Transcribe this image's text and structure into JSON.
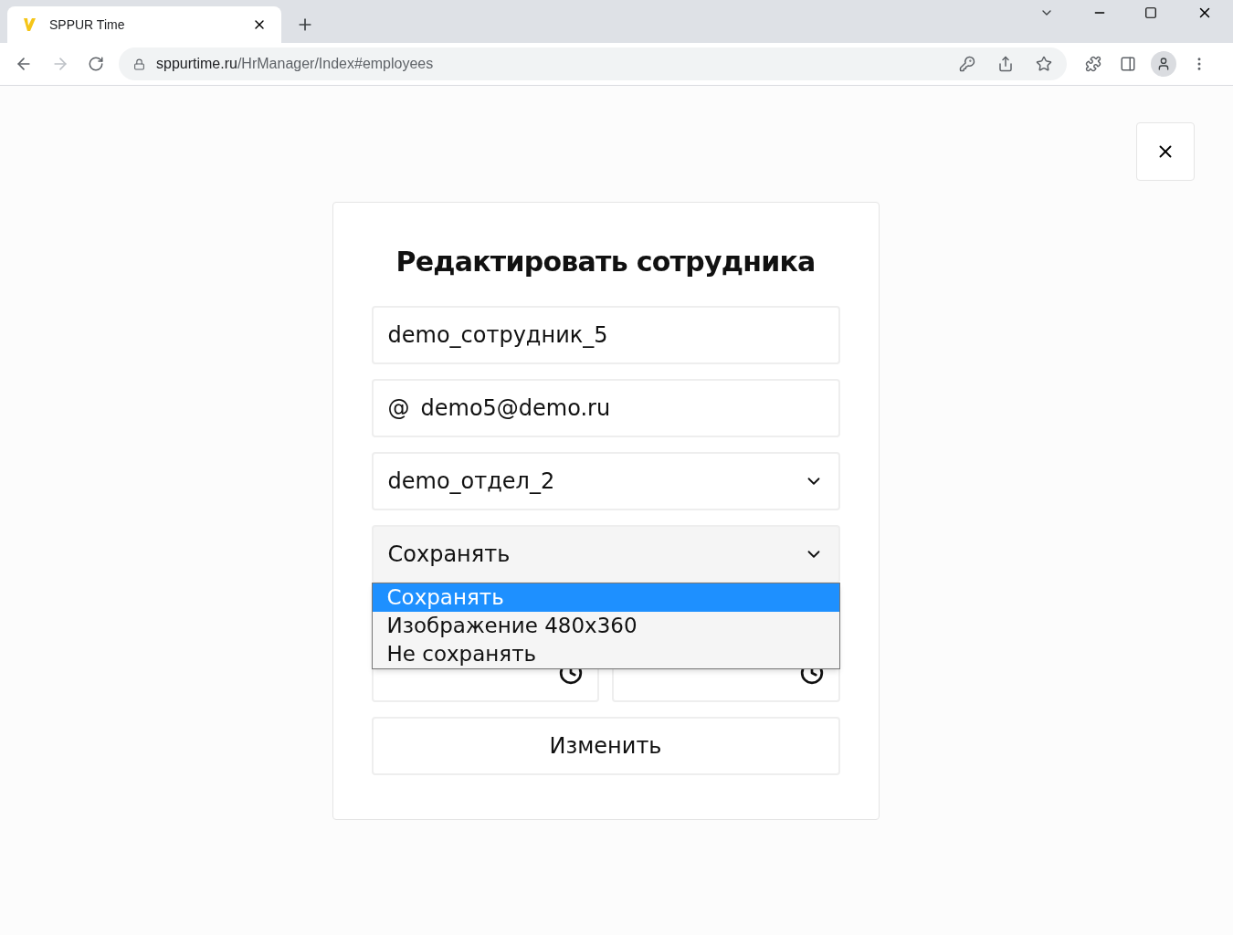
{
  "browser": {
    "tab_title": "SPPUR Time",
    "url_host": "sppurtime.ru",
    "url_path": "/HrManager/Index#employees"
  },
  "dialog": {
    "title": "Редактировать сотрудника",
    "name_field": {
      "value": "demo_сотрудник_5"
    },
    "email_field": {
      "prefix": "@",
      "value": "demo5@demo.ru"
    },
    "department_select": {
      "value": "demo_отдел_2"
    },
    "photo_select": {
      "value": "Сохранять",
      "expanded": true,
      "options": [
        {
          "label": "Сохранять",
          "selected": true
        },
        {
          "label": "Изображение 480x360",
          "selected": false
        },
        {
          "label": "Не сохранять",
          "selected": false
        }
      ]
    },
    "submit_button": "Изменить"
  }
}
